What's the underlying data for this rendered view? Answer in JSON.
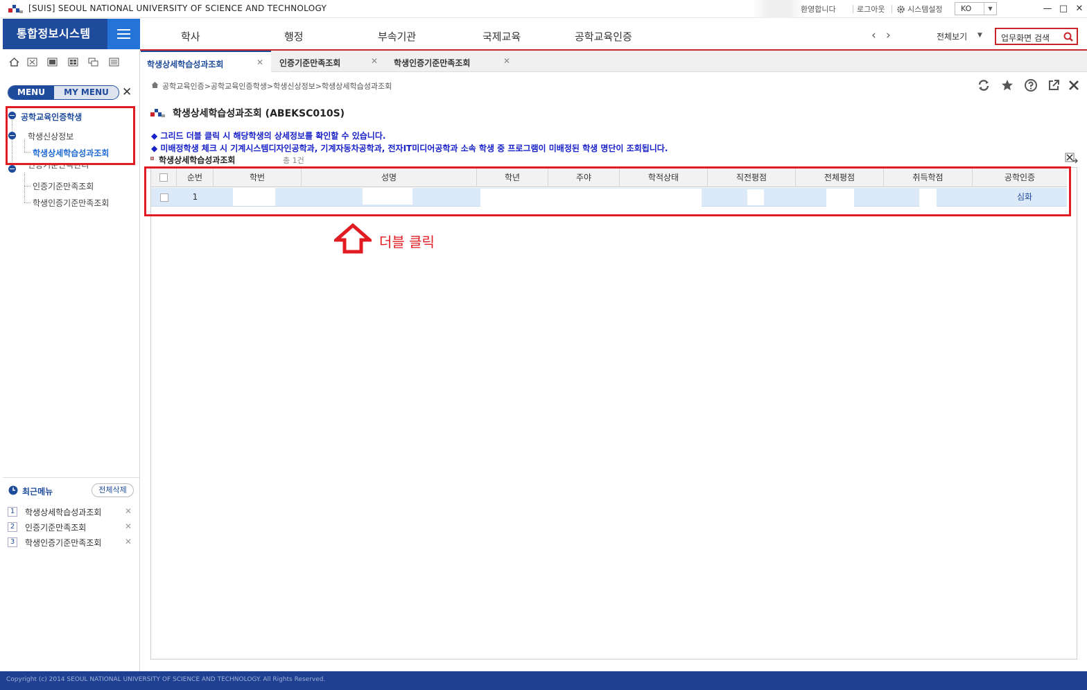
{
  "window": {
    "title": "[SUIS] SEOUL NATIONAL UNIVERSITY OF SCIENCE AND TECHNOLOGY",
    "welcome": "환영합니다",
    "logout": "로그아웃",
    "settings": "시스템설정",
    "language": "KO"
  },
  "header": {
    "brand": "통합정보시스템",
    "menus": [
      "학사",
      "행정",
      "부속기관",
      "국제교육",
      "공학교육인증"
    ],
    "view_all": "전체보기",
    "search_placeholder": "업무화면 검색"
  },
  "sidebar": {
    "menu_tab": "MENU",
    "my_menu_tab": "MY MENU",
    "tree": {
      "root": "공학교육인증학생",
      "group1": "학생신상정보",
      "group1_leaf": "학생상세학습성과조회",
      "group2": "인증기준만족관리",
      "group2_leaves": [
        "인증기준만족조회",
        "학생인증기준만족조회"
      ]
    },
    "recent": {
      "title": "최근메뉴",
      "clear_button": "전체삭제",
      "items": [
        {
          "num": "1",
          "label": "학생상세학습성과조회"
        },
        {
          "num": "2",
          "label": "인증기준만족조회"
        },
        {
          "num": "3",
          "label": "학생인증기준만족조회"
        }
      ]
    }
  },
  "tabs": [
    {
      "label": "학생상세학습성과조회",
      "active": true
    },
    {
      "label": "인증기준만족조회",
      "active": false
    },
    {
      "label": "학생인증기준만족조회",
      "active": false
    }
  ],
  "breadcrumb": "공학교육인증>공학교육인증학생>학생신상정보>학생상세학습성과조회",
  "page": {
    "title": "학생상세학습성과조회 (ABEKSC010S)",
    "notice1": "◆ 그리드 더블 클릭 시 해당학생의 상세정보를 확인할 수 있습니다.",
    "notice2": "◆ 미배정학생 체크 시 기계시스템디자인공학과, 기계자동차공학과, 전자IT미디어공학과 소속 학생 중 프로그램이 미배정된 학생 명단이 조회됩니다.",
    "grid_title": "학생상세학습성과조회",
    "grid_total": "총 1건"
  },
  "grid": {
    "columns": [
      "순번",
      "학번",
      "성명",
      "학년",
      "주야",
      "학적상태",
      "직전평점",
      "전체평점",
      "취득학점",
      "공학인증"
    ],
    "rows": [
      {
        "seq": "1",
        "cert": "심화"
      }
    ]
  },
  "annotation": {
    "label": "더블 클릭",
    "color": "#e01b22"
  },
  "footer": {
    "copyright": "Copyright (c) 2014 SEOUL NATIONAL UNIVERSITY OF SCIENCE AND TECHNOLOGY. All Rights Reserved."
  },
  "colors": {
    "brand": "#1e4b9b",
    "accent_red": "#c7242b",
    "notice_blue": "#1822c8",
    "row_selected": "#dce9f9"
  }
}
